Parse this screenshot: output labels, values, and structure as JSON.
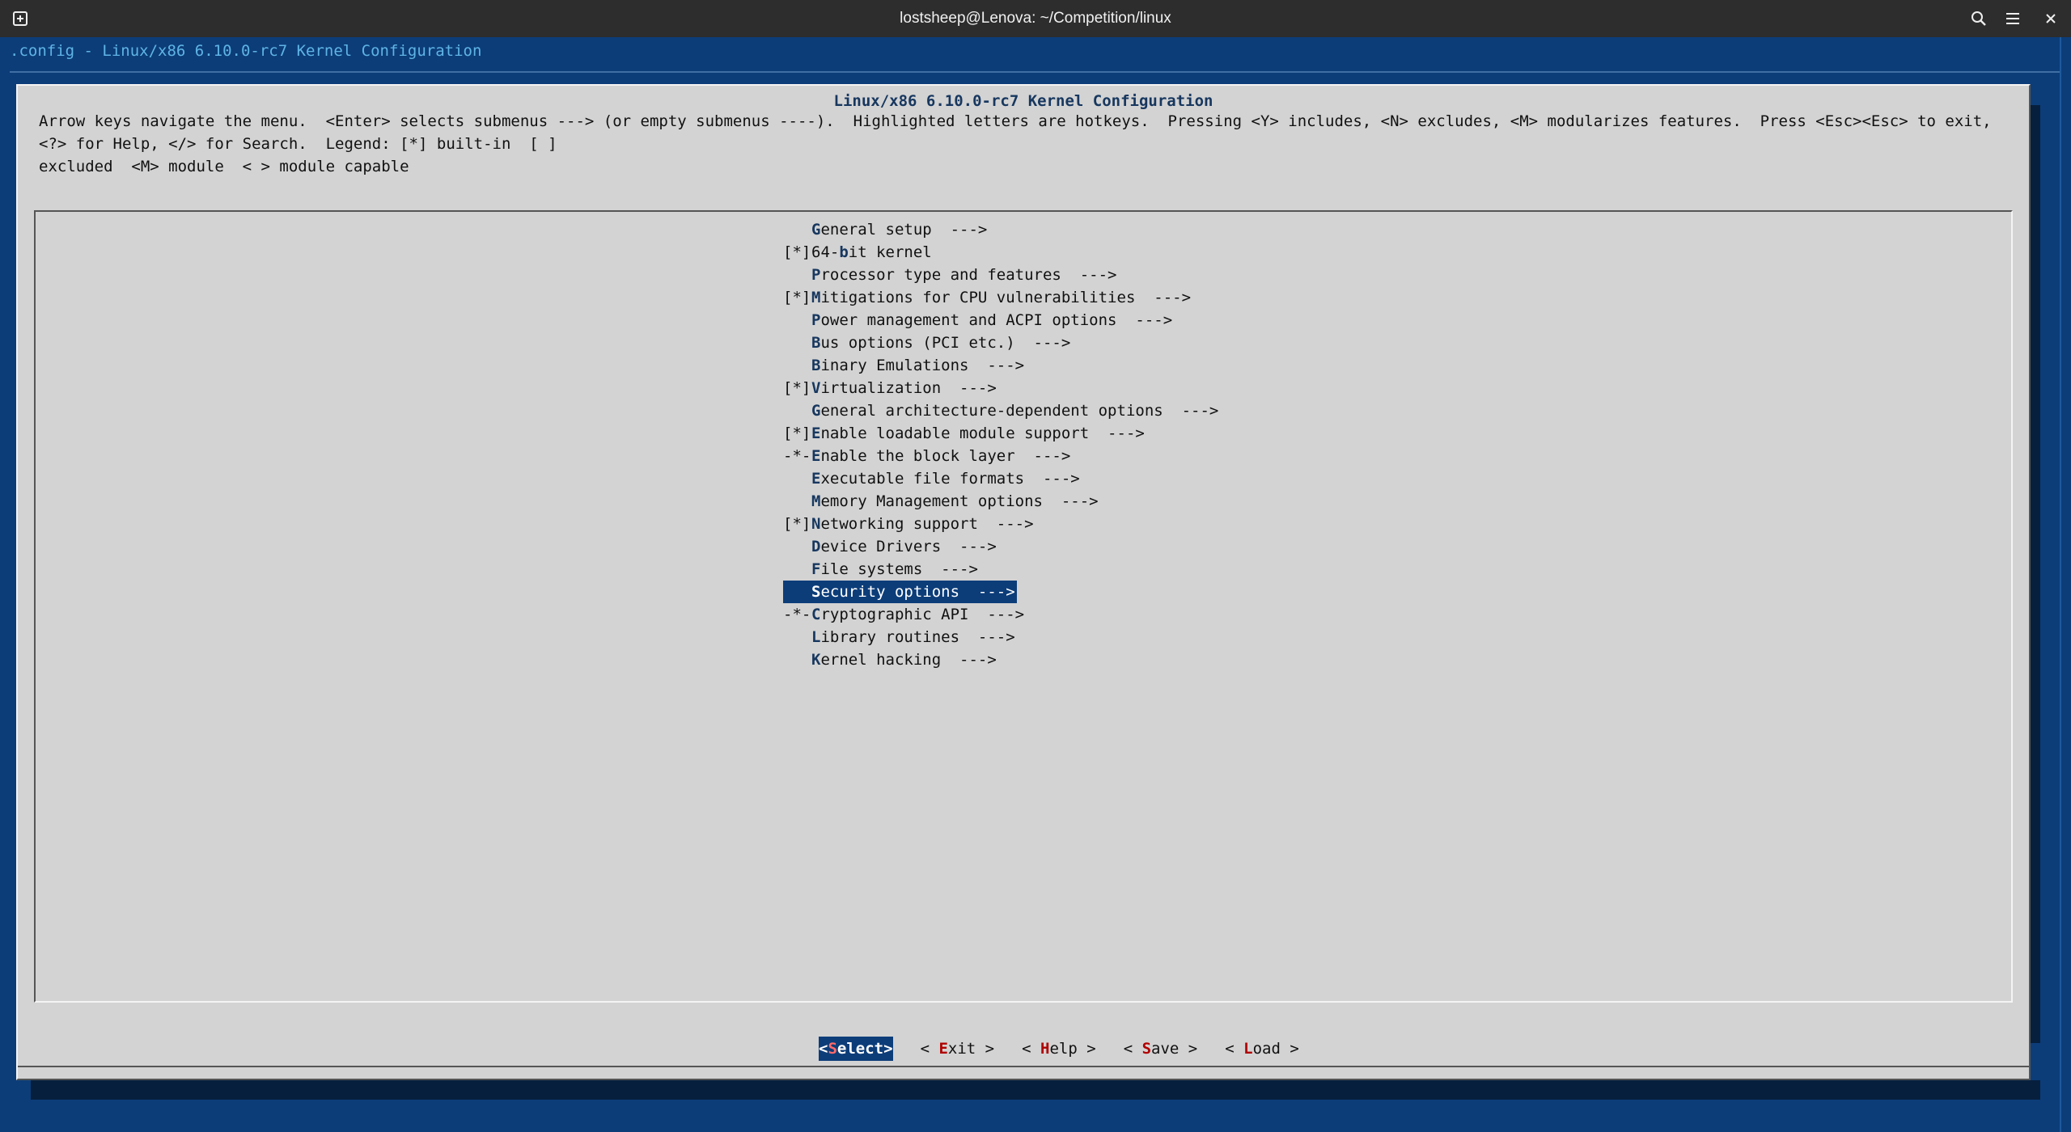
{
  "window": {
    "title": "lostsheep@Lenova: ~/Competition/linux",
    "icons": [
      "new-tab-icon",
      "search-icon",
      "menu-icon",
      "close-icon"
    ]
  },
  "backtitle": ".config - Linux/x86 6.10.0-rc7 Kernel Configuration",
  "dialog": {
    "title": "Linux/x86 6.10.0-rc7 Kernel Configuration",
    "help": "Arrow keys navigate the menu.  <Enter> selects submenus ---> (or empty submenus ----).  Highlighted letters are hotkeys.  Pressing <Y> includes, <N> excludes, <M> modularizes features.  Press <Esc><Esc> to exit, <?> for Help, </> for Search.  Legend: [*] built-in  [ ]\nexcluded  <M> module  < > module capable"
  },
  "menu": [
    {
      "prefix": "",
      "hotkey": "G",
      "rest": "eneral setup  --->"
    },
    {
      "prefix": "[*]",
      "pre": "64-",
      "hotkey": "b",
      "rest": "it kernel"
    },
    {
      "prefix": "",
      "hotkey": "P",
      "rest": "rocessor type and features  --->"
    },
    {
      "prefix": "[*]",
      "hotkey": "M",
      "rest": "itigations for CPU vulnerabilities  --->"
    },
    {
      "prefix": "",
      "hotkey": "P",
      "rest": "ower management and ACPI options  --->"
    },
    {
      "prefix": "",
      "hotkey": "B",
      "rest": "us options (PCI etc.)  --->"
    },
    {
      "prefix": "",
      "hotkey": "B",
      "rest": "inary Emulations  --->"
    },
    {
      "prefix": "[*]",
      "hotkey": "V",
      "rest": "irtualization  --->"
    },
    {
      "prefix": "",
      "hotkey": "G",
      "rest": "eneral architecture-dependent options  --->"
    },
    {
      "prefix": "[*]",
      "hotkey": "E",
      "rest": "nable loadable module support  --->"
    },
    {
      "prefix": "-*-",
      "hotkey": "E",
      "rest": "nable the block layer  --->"
    },
    {
      "prefix": "",
      "hotkey": "E",
      "rest": "xecutable file formats  --->"
    },
    {
      "prefix": "",
      "hotkey": "M",
      "rest": "emory Management options  --->"
    },
    {
      "prefix": "[*]",
      "hotkey": "N",
      "rest": "etworking support  --->"
    },
    {
      "prefix": "",
      "hotkey": "D",
      "rest": "evice Drivers  --->"
    },
    {
      "prefix": "",
      "hotkey": "F",
      "rest": "ile systems  --->"
    },
    {
      "prefix": "",
      "hotkey": "S",
      "rest": "ecurity options  --->",
      "selected": true
    },
    {
      "prefix": "-*-",
      "hotkey": "C",
      "rest": "ryptographic API  --->"
    },
    {
      "prefix": "",
      "hotkey": "L",
      "rest": "ibrary routines  --->"
    },
    {
      "prefix": "",
      "hotkey": "K",
      "rest": "ernel hacking  --->"
    }
  ],
  "buttons": [
    {
      "open": "<",
      "hotkey": "S",
      "rest": "elect",
      "close": ">",
      "selected": true
    },
    {
      "open": "< ",
      "hotkey": "E",
      "rest": "xit",
      "close": " >"
    },
    {
      "open": "< ",
      "hotkey": "H",
      "rest": "elp",
      "close": " >"
    },
    {
      "open": "< ",
      "hotkey": "S",
      "rest": "ave",
      "close": " >"
    },
    {
      "open": "< ",
      "hotkey": "L",
      "rest": "oad",
      "close": " >"
    }
  ]
}
